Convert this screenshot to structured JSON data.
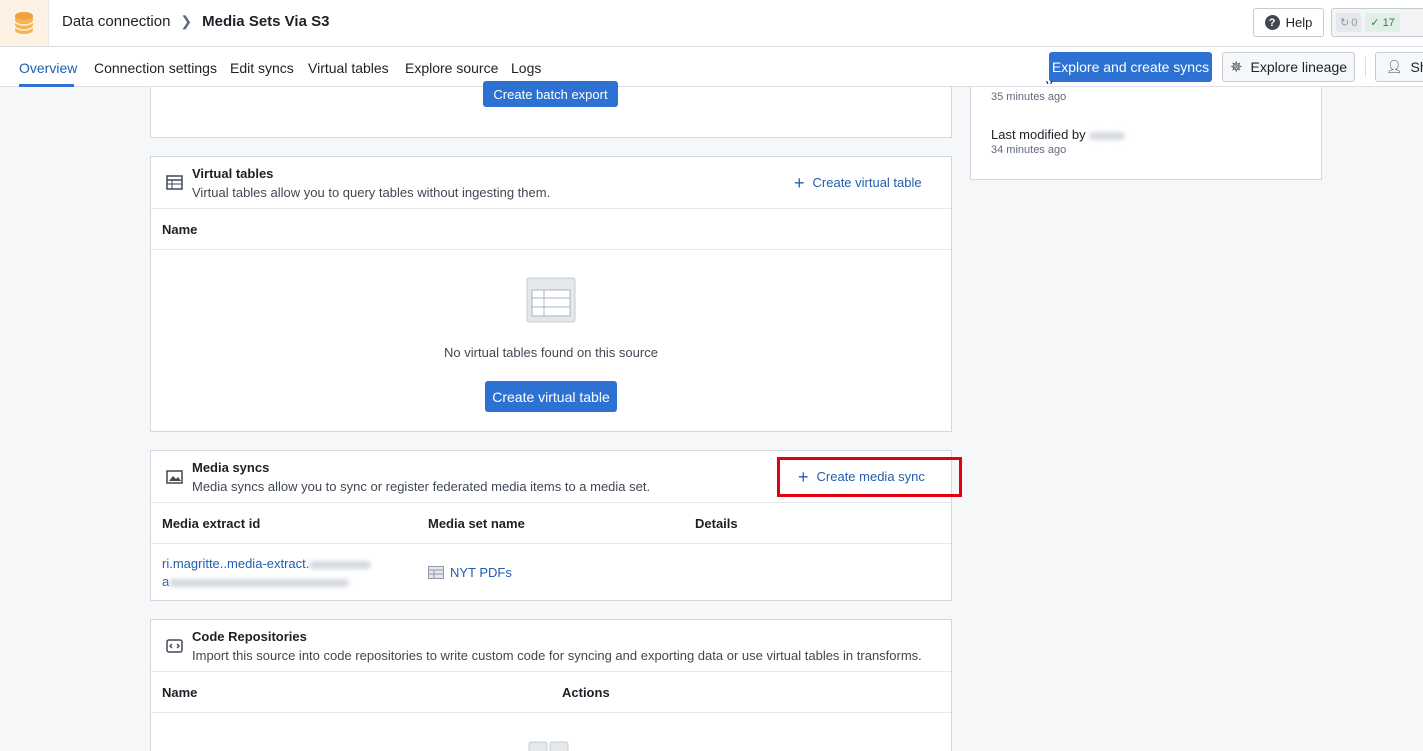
{
  "header": {
    "app_name": "Data connection",
    "source_name": "Media Sets Via S3",
    "help_label": "Help",
    "sync_count": "0",
    "success_count": "17"
  },
  "tabs": [
    {
      "label": "Overview",
      "active": true
    },
    {
      "label": "Connection settings"
    },
    {
      "label": "Edit syncs"
    },
    {
      "label": "Virtual tables"
    },
    {
      "label": "Explore source"
    },
    {
      "label": "Logs"
    }
  ],
  "actions": {
    "explore_create_syncs": "Explore and create syncs",
    "explore_lineage": "Explore lineage",
    "share_partial": "Sh"
  },
  "batch_export": {
    "button_label": "Create batch export"
  },
  "side_panel": {
    "created_time": "35 minutes ago",
    "last_modified_label": "Last modified by",
    "last_modified_time": "34 minutes ago"
  },
  "virtual_tables": {
    "title": "Virtual tables",
    "description": "Virtual tables allow you to query tables without ingesting them.",
    "create_link": "Create virtual table",
    "columns": [
      "Name"
    ],
    "empty_text": "No virtual tables found on this source",
    "create_button": "Create virtual table"
  },
  "media_syncs": {
    "title": "Media syncs",
    "description": "Media syncs allow you to sync or register federated media items to a media set.",
    "create_link": "Create media sync",
    "columns": [
      "Media extract id",
      "Media set name",
      "Details"
    ],
    "rows": [
      {
        "extract_id": "ri.magritte..media-extract.",
        "extract_id_line2": "a",
        "media_set": "NYT PDFs",
        "details": ""
      }
    ]
  },
  "code_repositories": {
    "title": "Code Repositories",
    "description": "Import this source into code repositories to write custom code for syncing and exporting data or use virtual tables in transforms.",
    "columns": [
      "Name",
      "Actions"
    ]
  },
  "colors": {
    "primary": "#2d72d2",
    "link": "#215db0",
    "highlight": "#e00010",
    "success": "#238551"
  }
}
